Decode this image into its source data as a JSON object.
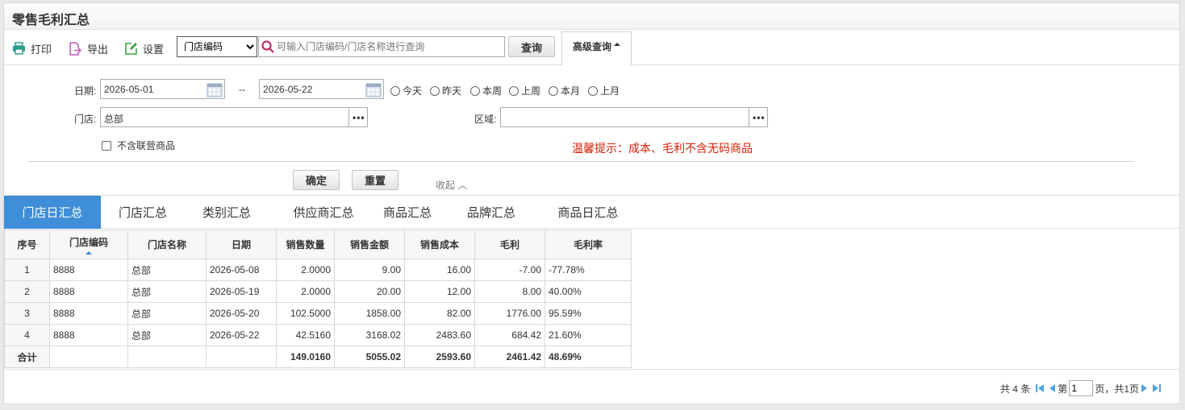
{
  "page": {
    "title": "零售毛利汇总"
  },
  "toolbar": {
    "print_label": "打印",
    "export_label": "导出",
    "settings_label": "设置",
    "search_field_selected": "门店编码",
    "search_placeholder": "可输入门店编码/门店名称进行查询",
    "query_label": "查询",
    "advanced_label": "高级查询"
  },
  "filter": {
    "date_label": "日期:",
    "date_from": "2026-05-01",
    "date_sep": "--",
    "date_to": "2026-05-22",
    "quick_dates": [
      "今天",
      "昨天",
      "本周",
      "上周",
      "本月",
      "上月"
    ],
    "store_label": "门店:",
    "store_value": "总部",
    "region_label": "区域:",
    "region_value": "",
    "exclude_joint_label": "不含联营商品",
    "warning": "温馨提示：成本、毛利不含无码商品",
    "confirm_label": "确定",
    "reset_label": "重置",
    "collapse_label": "收起"
  },
  "tabs": [
    "门店日汇总",
    "门店汇总",
    "类别汇总",
    "供应商汇总",
    "商品汇总",
    "品牌汇总",
    "商品日汇总"
  ],
  "table": {
    "headers": [
      "序号",
      "门店编码",
      "门店名称",
      "日期",
      "销售数量",
      "销售金额",
      "销售成本",
      "毛利",
      "毛利率"
    ],
    "rows": [
      [
        "1",
        "8888",
        "总部",
        "2026-05-08",
        "2.0000",
        "9.00",
        "16.00",
        "-7.00",
        "-77.78%"
      ],
      [
        "2",
        "8888",
        "总部",
        "2026-05-19",
        "2.0000",
        "20.00",
        "12.00",
        "8.00",
        "40.00%"
      ],
      [
        "3",
        "8888",
        "总部",
        "2026-05-20",
        "102.5000",
        "1858.00",
        "82.00",
        "1776.00",
        "95.59%"
      ],
      [
        "4",
        "8888",
        "总部",
        "2026-05-22",
        "42.5160",
        "3168.02",
        "2483.60",
        "684.42",
        "21.60%"
      ]
    ],
    "total": [
      "合计",
      "",
      "",
      "",
      "149.0160",
      "5055.02",
      "2593.60",
      "2461.42",
      "48.69%"
    ]
  },
  "pager": {
    "total_text": "共 4 条",
    "page_prefix": "第",
    "page_value": "1",
    "page_suffix": "页，共1页"
  },
  "colors": {
    "accent": "#3f8ed9",
    "warning": "#d81e06"
  }
}
